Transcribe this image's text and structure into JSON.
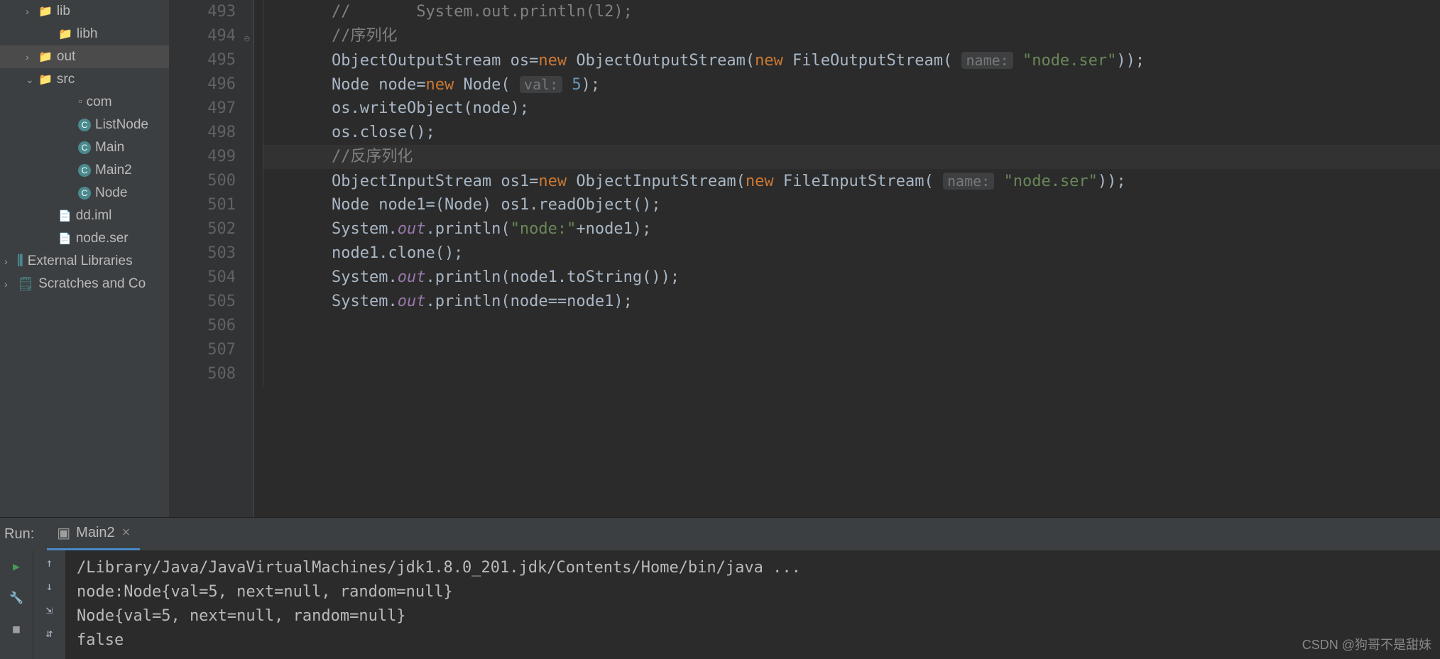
{
  "tree": {
    "items": [
      {
        "label": "lib",
        "type": "folder",
        "indent": 1,
        "chev": "right"
      },
      {
        "label": "libh",
        "type": "folder",
        "indent": 2,
        "chev": ""
      },
      {
        "label": "out",
        "type": "folder-orange",
        "indent": 1,
        "chev": "right",
        "selected": true
      },
      {
        "label": "src",
        "type": "folder-blue",
        "indent": 1,
        "chev": "down"
      },
      {
        "label": "com",
        "type": "package",
        "indent": 3,
        "chev": ""
      },
      {
        "label": "ListNode",
        "type": "class",
        "indent": 3,
        "chev": ""
      },
      {
        "label": "Main",
        "type": "class",
        "indent": 3,
        "chev": ""
      },
      {
        "label": "Main2",
        "type": "class-run",
        "indent": 3,
        "chev": ""
      },
      {
        "label": "Node",
        "type": "class",
        "indent": 3,
        "chev": ""
      },
      {
        "label": "dd.iml",
        "type": "file",
        "indent": 2,
        "chev": ""
      },
      {
        "label": "node.ser",
        "type": "file",
        "indent": 2,
        "chev": ""
      },
      {
        "label": "External Libraries",
        "type": "lib",
        "indent": 0,
        "chev": "right"
      },
      {
        "label": "Scratches and Co",
        "type": "scratch",
        "indent": 0,
        "chev": "right"
      }
    ]
  },
  "editor": {
    "startLine": 493,
    "endLine": 508,
    "lines": [
      {
        "n": 493,
        "segs": [
          {
            "t": "//       System.out.println(l2);",
            "c": "com"
          }
        ]
      },
      {
        "n": 494,
        "segs": [
          {
            "t": "//序列化",
            "c": "com"
          }
        ]
      },
      {
        "n": 495,
        "segs": [
          {
            "t": "ObjectOutputStream os="
          },
          {
            "t": "new",
            "c": "kw"
          },
          {
            "t": " ObjectOutputStream("
          },
          {
            "t": "new",
            "c": "kw"
          },
          {
            "t": " FileOutputStream( "
          },
          {
            "t": "name:",
            "c": "param-hint"
          },
          {
            "t": " "
          },
          {
            "t": "\"node.ser\"",
            "c": "str"
          },
          {
            "t": "));"
          }
        ]
      },
      {
        "n": 496,
        "segs": [
          {
            "t": "Node node="
          },
          {
            "t": "new",
            "c": "kw"
          },
          {
            "t": " Node( "
          },
          {
            "t": "val:",
            "c": "param-hint"
          },
          {
            "t": " "
          },
          {
            "t": "5",
            "c": "num"
          },
          {
            "t": ");"
          }
        ]
      },
      {
        "n": 497,
        "segs": [
          {
            "t": "os.writeObject(node);"
          }
        ]
      },
      {
        "n": 498,
        "segs": [
          {
            "t": "os.close();"
          }
        ]
      },
      {
        "n": 499,
        "hl": true,
        "segs": [
          {
            "t": "//反序列化",
            "c": "com"
          }
        ]
      },
      {
        "n": 500,
        "segs": [
          {
            "t": "ObjectInputStream os1="
          },
          {
            "t": "new",
            "c": "kw"
          },
          {
            "t": " ObjectInputStream("
          },
          {
            "t": "new",
            "c": "kw"
          },
          {
            "t": " FileInputStream( "
          },
          {
            "t": "name:",
            "c": "param-hint"
          },
          {
            "t": " "
          },
          {
            "t": "\"node.ser\"",
            "c": "str"
          },
          {
            "t": "));"
          }
        ]
      },
      {
        "n": 501,
        "segs": [
          {
            "t": "Node node1=(Node) os1.readObject();"
          }
        ]
      },
      {
        "n": 502,
        "segs": [
          {
            "t": "System."
          },
          {
            "t": "out",
            "c": "field"
          },
          {
            "t": ".println("
          },
          {
            "t": "\"node:\"",
            "c": "str"
          },
          {
            "t": "+node1);"
          }
        ]
      },
      {
        "n": 503,
        "segs": [
          {
            "t": "node1.clone();"
          }
        ]
      },
      {
        "n": 504,
        "segs": [
          {
            "t": "System."
          },
          {
            "t": "out",
            "c": "field"
          },
          {
            "t": ".println(node1."
          },
          {
            "t": "toString",
            "c": "method"
          },
          {
            "t": "());"
          }
        ]
      },
      {
        "n": 505,
        "segs": [
          {
            "t": "System."
          },
          {
            "t": "out",
            "c": "field"
          },
          {
            "t": ".println(node==node1);"
          }
        ]
      },
      {
        "n": 506,
        "segs": []
      },
      {
        "n": 507,
        "segs": []
      },
      {
        "n": 508,
        "segs": []
      }
    ],
    "indent_prefix": "            "
  },
  "run": {
    "label": "Run:",
    "tabName": "Main2",
    "console": [
      "/Library/Java/JavaVirtualMachines/jdk1.8.0_201.jdk/Contents/Home/bin/java ...",
      "node:Node{val=5, next=null, random=null}",
      "Node{val=5, next=null, random=null}",
      "false"
    ]
  },
  "watermark": "CSDN @狗哥不是甜妹"
}
